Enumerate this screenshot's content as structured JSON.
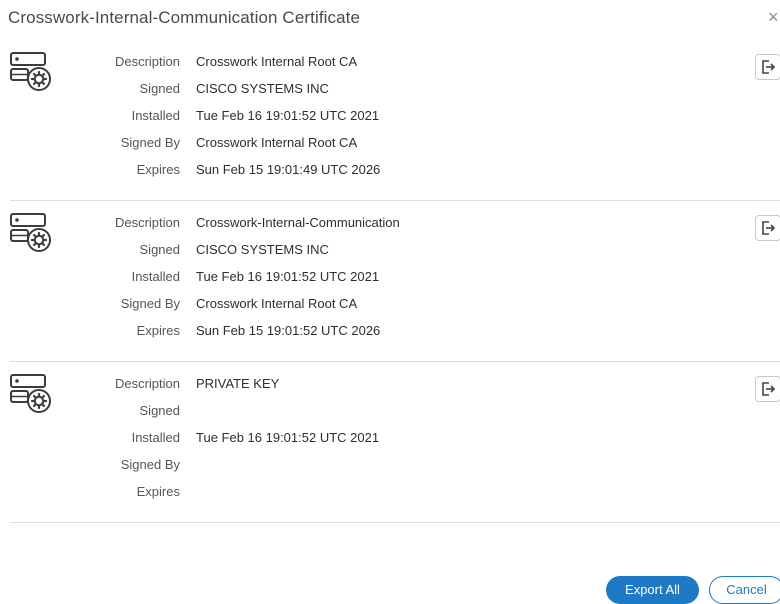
{
  "dialog": {
    "title": "Crosswork-Internal-Communication Certificate",
    "close_icon": "close-icon",
    "close_glyph": "×"
  },
  "labels": {
    "description": "Description",
    "signed": "Signed",
    "installed": "Installed",
    "signed_by": "Signed By",
    "expires": "Expires"
  },
  "certificates": [
    {
      "icon": "certificate-server-gear-icon",
      "description": "Crosswork Internal Root CA",
      "signed": "CISCO SYSTEMS INC",
      "installed": "Tue Feb 16 19:01:52 UTC 2021",
      "signed_by": "Crosswork Internal Root CA",
      "expires": "Sun Feb 15 19:01:49 UTC 2026",
      "export_icon": "export-icon"
    },
    {
      "icon": "certificate-server-gear-icon",
      "description": "Crosswork-Internal-Communication",
      "signed": "CISCO SYSTEMS INC",
      "installed": "Tue Feb 16 19:01:52 UTC 2021",
      "signed_by": "Crosswork Internal Root CA",
      "expires": "Sun Feb 15 19:01:52 UTC 2026",
      "export_icon": "export-icon"
    },
    {
      "icon": "certificate-server-gear-icon",
      "description": "PRIVATE KEY",
      "signed": "",
      "installed": "Tue Feb 16 19:01:52 UTC 2021",
      "signed_by": "",
      "expires": "",
      "export_icon": "export-icon"
    }
  ],
  "footer": {
    "export_all_label": "Export All",
    "cancel_label": "Cancel"
  },
  "colors": {
    "primary": "#1f79c4",
    "divider": "#dedede",
    "title_text": "#4a4a4a"
  }
}
